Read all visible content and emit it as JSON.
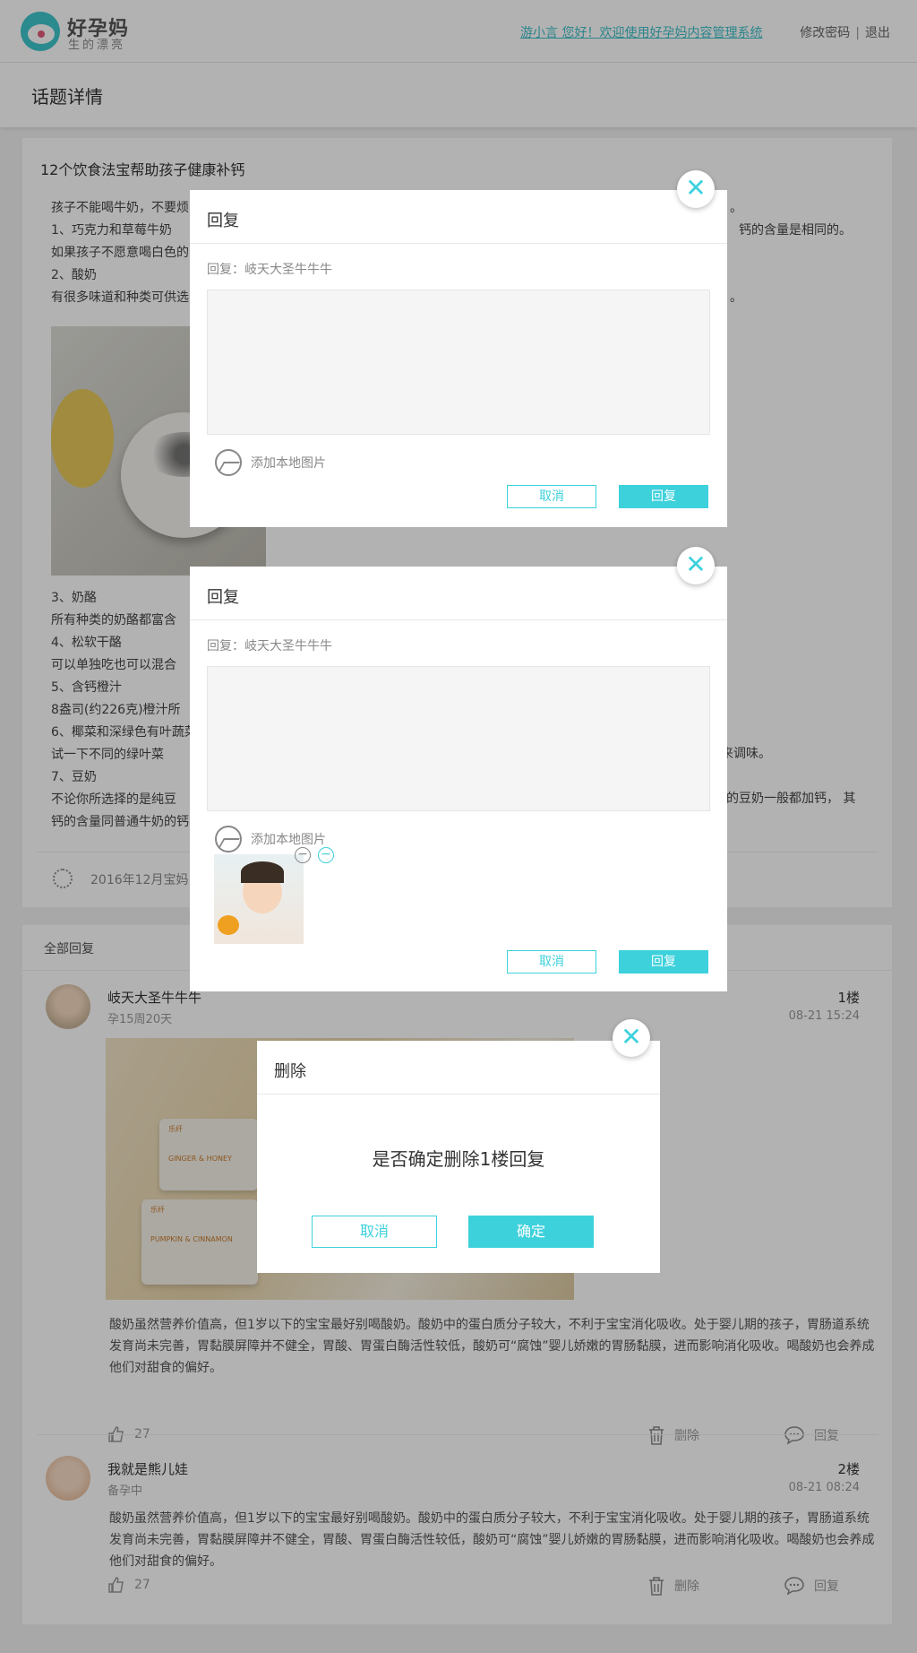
{
  "header": {
    "logo_title": "好孕妈",
    "logo_subtitle": "生的漂亮",
    "welcome_text": "游小言 您好！欢迎使用好孕妈内容管理系统",
    "change_password": "修改密码",
    "separator": "|",
    "logout": "退出"
  },
  "page": {
    "title": "话题详情"
  },
  "topic": {
    "title": "12个饮食法宝帮助孩子健康补钙",
    "body_lines": [
      "孩子不能喝牛奶，不要烦",
      " 1、巧克力和草莓牛奶",
      "如果孩子不愿意喝白色的",
      "2、酸奶",
      "有很多味道和种类可供选"
    ],
    "body_lines_right": [
      "。",
      "钙的含量是相同的。",
      "",
      "",
      "。"
    ],
    "body_lines_2": [
      "3、奶酪",
      "    所有种类的奶酪都富含",
      "4、松软干酪",
      "     可以单独吃也可以混合",
      "5、含钙橙汁",
      "    8盎司(约226克)橙汁所",
      "6、椰菜和深绿色有叶蔬菜",
      "    试一下不同的绿叶菜",
      "7、豆奶",
      "    不论你所选择的是纯豆",
      "钙的含量同普通牛奶的钙"
    ],
    "right_fragment_1": "牛油来调味。",
    "right_fragment_2": "的豆奶一般都加钙， 其",
    "date": "2016年12月宝妈"
  },
  "replies": {
    "title": "全部回复",
    "items": [
      {
        "name": "岐天大圣牛牛牛",
        "sub": "孕15周20天",
        "floor": "1楼",
        "time": "08-21 15:24",
        "photo_label_1": "乐纤",
        "photo_label_2": "GINGER & HONEY",
        "photo_label_3": "乐纤",
        "photo_label_4": "PUMPKIN & CINNAMON",
        "text": "酸奶虽然营养价值高，但1岁以下的宝宝最好别喝酸奶。酸奶中的蛋白质分子较大，不利于宝宝消化吸收。处于婴儿期的孩子，胃肠道系统发育尚未完善，胃黏膜屏障并不健全，胃酸、胃蛋白酶活性较低，酸奶可“腐蚀”婴儿娇嫩的胃肠黏膜，进而影响消化吸收。喝酸奶也会养成他们对甜食的偏好。",
        "likes": "27",
        "delete": "删除",
        "reply": "回复"
      },
      {
        "name": "我就是熊儿娃",
        "sub": "备孕中",
        "floor": "2楼",
        "time": "08-21 08:24",
        "text": "酸奶虽然营养价值高，但1岁以下的宝宝最好别喝酸奶。酸奶中的蛋白质分子较大，不利于宝宝消化吸收。处于婴儿期的孩子，胃肠道系统发育尚未完善，胃黏膜屏障并不健全，胃酸、胃蛋白酶活性较低，酸奶可“腐蚀”婴儿娇嫩的胃肠黏膜，进而影响消化吸收。喝酸奶也会养成他们对甜食的偏好。",
        "likes": "27",
        "delete": "删除",
        "reply": "回复"
      }
    ]
  },
  "modal1": {
    "title": "回复",
    "reply_to": "回复：岐天大圣牛牛牛",
    "add_image": "添加本地图片",
    "cancel": "取消",
    "submit": "回复"
  },
  "modal2": {
    "title": "回复",
    "reply_to": "回复：岐天大圣牛牛牛",
    "add_image": "添加本地图片",
    "cancel": "取消",
    "submit": "回复"
  },
  "modal3": {
    "title": "删除",
    "question": "是否确定删除1楼回复",
    "cancel": "取消",
    "confirm": "确定"
  },
  "colors": {
    "accent": "#3dd1dc",
    "link": "#3dbfc8"
  },
  "icons": [
    "logo-icon",
    "close-icon",
    "image-icon",
    "like-icon",
    "trash-icon",
    "comment-icon",
    "minus-icon",
    "loading-icon"
  ]
}
